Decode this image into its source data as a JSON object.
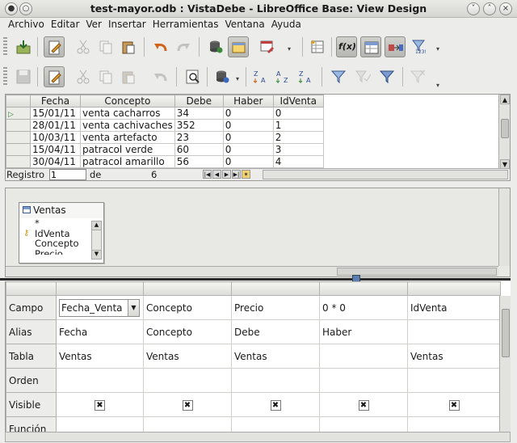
{
  "window": {
    "title": "test-mayor.odb : VistaDebe - LibreOffice Base: View Design"
  },
  "menu": [
    "Archivo",
    "Editar",
    "Ver",
    "Insertar",
    "Herramientas",
    "Ventana",
    "Ayuda"
  ],
  "toolbar1": [
    "save-to-file-icon",
    "edit-mode-icon",
    "cut-icon",
    "copy-icon",
    "paste-icon",
    "undo-icon",
    "redo-icon",
    "run-query-icon",
    "add-tables-icon",
    "clear-query-icon",
    "functions-icon",
    "table-name-icon",
    "alias-icon",
    "distinct-values-icon"
  ],
  "toolbar1_labels": {
    "functions": "f(x)",
    "distinct": "123!"
  },
  "toolbar2": [
    "save-icon",
    "edit-icon",
    "cut-icon",
    "copy-icon",
    "paste-icon",
    "find-icon",
    "refresh-icon",
    "sort-icon",
    "sort-ascending-icon",
    "sort-descending-icon",
    "autofilter-icon",
    "apply-filter-icon",
    "standard-filter-icon",
    "remove-filter-icon"
  ],
  "results": {
    "columns": [
      "Fecha",
      "Concepto",
      "Debe",
      "Haber",
      "IdVenta"
    ],
    "rows": [
      [
        "15/01/11",
        "venta cacharros",
        "34",
        "0",
        "0"
      ],
      [
        "28/01/11",
        "venta cachivaches",
        "352",
        "0",
        "1"
      ],
      [
        "10/03/11",
        "venta artefacto",
        "23",
        "0",
        "2"
      ],
      [
        "15/04/11",
        "patracol verde",
        "60",
        "0",
        "3"
      ],
      [
        "30/04/11",
        "patracol amarillo",
        "56",
        "0",
        "4"
      ]
    ],
    "navigator": {
      "label": "Registro",
      "current": "1",
      "of_label": "de",
      "total": "6"
    }
  },
  "table_window": {
    "name": "Ventas",
    "fields": [
      "*",
      "IdVenta",
      "Concepto",
      "Precio"
    ]
  },
  "design_grid": {
    "row_labels": [
      "Campo",
      "Alias",
      "Tabla",
      "Orden",
      "Visible",
      "Función"
    ],
    "columns": [
      {
        "field": "Fecha_Venta",
        "alias": "Fecha",
        "table": "Ventas",
        "visible": true
      },
      {
        "field": "Concepto",
        "alias": "Concepto",
        "table": "Ventas",
        "visible": true
      },
      {
        "field": "Precio",
        "alias": "Debe",
        "table": "Ventas",
        "visible": true
      },
      {
        "field": "0 * 0",
        "alias": "Haber",
        "table": "",
        "visible": true
      },
      {
        "field": "IdVenta",
        "alias": "",
        "table": "Ventas",
        "visible": true
      }
    ]
  }
}
